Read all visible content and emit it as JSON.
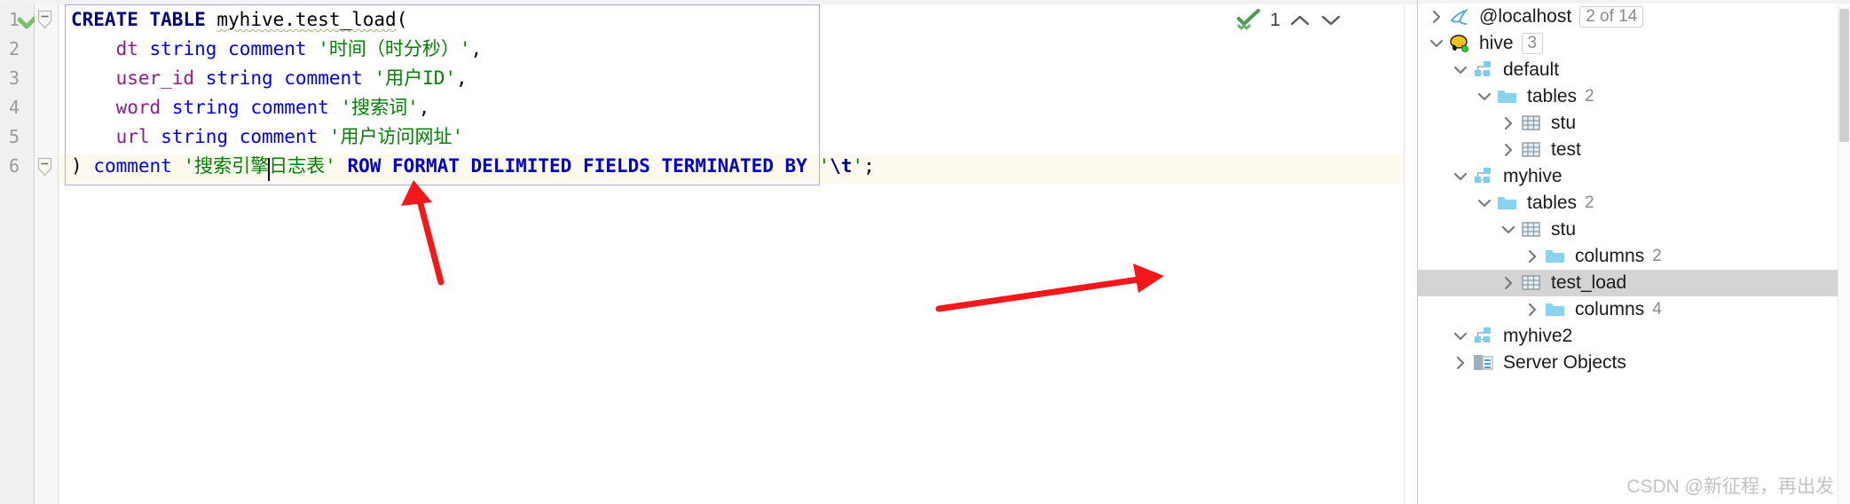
{
  "editor": {
    "gutter_line_numbers": [
      "1",
      "2",
      "3",
      "4",
      "5",
      "6"
    ],
    "inspection": {
      "count": "1",
      "up_glyph": "⌃",
      "down_glyph": "⌄"
    },
    "code_lines": [
      {
        "n": 1,
        "tokens": [
          {
            "t": "CREATE",
            "c": "kw"
          },
          {
            "t": " ",
            "c": "punct"
          },
          {
            "t": "TABLE",
            "c": "kw"
          },
          {
            "t": " ",
            "c": "punct"
          },
          {
            "t": "myhive.test_load",
            "c": "ident wavy"
          },
          {
            "t": "(",
            "c": "punct"
          }
        ],
        "plain": "CREATE TABLE myhive.test_load("
      },
      {
        "n": 2,
        "tokens": [
          {
            "t": "    ",
            "c": "punct"
          },
          {
            "t": "dt",
            "c": "col"
          },
          {
            "t": " ",
            "c": "punct"
          },
          {
            "t": "string",
            "c": "type"
          },
          {
            "t": " ",
            "c": "punct"
          },
          {
            "t": "comment",
            "c": "cmtkw"
          },
          {
            "t": " ",
            "c": "punct"
          },
          {
            "t": "'时间（时分秒）'",
            "c": "str"
          },
          {
            "t": ",",
            "c": "punct"
          }
        ],
        "plain": "    dt string comment '时间（时分秒）',"
      },
      {
        "n": 3,
        "tokens": [
          {
            "t": "    ",
            "c": "punct"
          },
          {
            "t": "user_id",
            "c": "col"
          },
          {
            "t": " ",
            "c": "punct"
          },
          {
            "t": "string",
            "c": "type"
          },
          {
            "t": " ",
            "c": "punct"
          },
          {
            "t": "comment",
            "c": "cmtkw"
          },
          {
            "t": " ",
            "c": "punct"
          },
          {
            "t": "'用户ID'",
            "c": "str"
          },
          {
            "t": ",",
            "c": "punct"
          }
        ],
        "plain": "    user_id string comment '用户ID',"
      },
      {
        "n": 4,
        "tokens": [
          {
            "t": "    ",
            "c": "punct"
          },
          {
            "t": "word",
            "c": "col"
          },
          {
            "t": " ",
            "c": "punct"
          },
          {
            "t": "string",
            "c": "type"
          },
          {
            "t": " ",
            "c": "punct"
          },
          {
            "t": "comment",
            "c": "cmtkw"
          },
          {
            "t": " ",
            "c": "punct"
          },
          {
            "t": "'搜索词'",
            "c": "str"
          },
          {
            "t": ",",
            "c": "punct"
          }
        ],
        "plain": "    word string comment '搜索词',"
      },
      {
        "n": 5,
        "tokens": [
          {
            "t": "    ",
            "c": "punct"
          },
          {
            "t": "url",
            "c": "col"
          },
          {
            "t": " ",
            "c": "punct"
          },
          {
            "t": "string",
            "c": "type"
          },
          {
            "t": " ",
            "c": "punct"
          },
          {
            "t": "comment",
            "c": "cmtkw"
          },
          {
            "t": " ",
            "c": "punct"
          },
          {
            "t": "'用户访问网址'",
            "c": "str"
          }
        ],
        "plain": "    url string comment '用户访问网址'"
      },
      {
        "n": 6,
        "tokens": [
          {
            "t": ")",
            "c": "punct"
          },
          {
            "t": " ",
            "c": "punct"
          },
          {
            "t": "comment",
            "c": "cmtkw"
          },
          {
            "t": " ",
            "c": "punct"
          },
          {
            "t": "'搜索引擎日志表'",
            "c": "str"
          },
          {
            "t": " ",
            "c": "punct"
          },
          {
            "t": "ROW FORMAT DELIMITED FIELDS TERMINATED BY",
            "c": "kwb"
          },
          {
            "t": " ",
            "c": "punct"
          },
          {
            "t": "'",
            "c": "str"
          },
          {
            "t": "\\t",
            "c": "esc"
          },
          {
            "t": "'",
            "c": "str"
          },
          {
            "t": ";",
            "c": "punct"
          }
        ],
        "plain": ") comment '搜索引擎日志表' ROW FORMAT DELIMITED FIELDS TERMINATED BY '\\t';"
      }
    ]
  },
  "tree": {
    "rows": [
      {
        "indent": 0,
        "twisty": "collapsed",
        "icon": "mysql-dolphin-icon",
        "label": "@localhost",
        "badge": "2 of 14",
        "badge_boxed": true,
        "selected": false
      },
      {
        "indent": 0,
        "twisty": "expanded",
        "icon": "hive-elephant-icon",
        "label": "hive",
        "badge": "3",
        "badge_boxed": true,
        "selected": false
      },
      {
        "indent": 1,
        "twisty": "expanded",
        "icon": "schema-icon",
        "label": "default",
        "badge": "",
        "badge_boxed": false,
        "selected": false
      },
      {
        "indent": 2,
        "twisty": "expanded",
        "icon": "folder-icon",
        "label": "tables",
        "badge": "2",
        "badge_boxed": false,
        "selected": false
      },
      {
        "indent": 3,
        "twisty": "collapsed",
        "icon": "table-icon",
        "label": "stu",
        "badge": "",
        "badge_boxed": false,
        "selected": false
      },
      {
        "indent": 3,
        "twisty": "collapsed",
        "icon": "table-icon",
        "label": "test",
        "badge": "",
        "badge_boxed": false,
        "selected": false
      },
      {
        "indent": 1,
        "twisty": "expanded",
        "icon": "schema-icon",
        "label": "myhive",
        "badge": "",
        "badge_boxed": false,
        "selected": false
      },
      {
        "indent": 2,
        "twisty": "expanded",
        "icon": "folder-icon",
        "label": "tables",
        "badge": "2",
        "badge_boxed": false,
        "selected": false
      },
      {
        "indent": 3,
        "twisty": "expanded",
        "icon": "table-icon",
        "label": "stu",
        "badge": "",
        "badge_boxed": false,
        "selected": false
      },
      {
        "indent": 4,
        "twisty": "collapsed",
        "icon": "folder-icon",
        "label": "columns",
        "badge": "2",
        "badge_boxed": false,
        "selected": false
      },
      {
        "indent": 3,
        "twisty": "collapsed",
        "icon": "table-icon",
        "label": "test_load",
        "badge": "",
        "badge_boxed": false,
        "selected": true
      },
      {
        "indent": 4,
        "twisty": "collapsed",
        "icon": "folder-icon",
        "label": "columns",
        "badge": "4",
        "badge_boxed": false,
        "selected": false
      },
      {
        "indent": 1,
        "twisty": "expanded",
        "icon": "schema-icon",
        "label": "myhive2",
        "badge": "",
        "badge_boxed": false,
        "selected": false
      },
      {
        "indent": 1,
        "twisty": "collapsed",
        "icon": "server-objects-icon",
        "label": "Server Objects",
        "badge": "",
        "badge_boxed": false,
        "selected": false
      }
    ]
  },
  "watermark": {
    "text": "CSDN @新征程，再出发"
  },
  "colors": {
    "accent_purple": "#b3a6e0",
    "arrow_red": "#f5181a",
    "selection_gray": "#d4d4d4",
    "string_green": "#008000",
    "keyword_blue": "#000080",
    "column_magenta": "#8e1e8e"
  }
}
